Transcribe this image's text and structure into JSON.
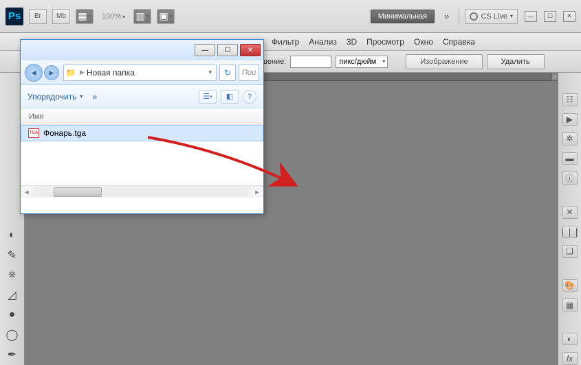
{
  "topbar": {
    "ps_label": "Ps",
    "br_label": "Br",
    "mb_label": "Mb",
    "zoom": "100%",
    "workspace": "Минимальная",
    "cs_live": "CS Live"
  },
  "menu": {
    "filter": "Фильтр",
    "analysis": "Анализ",
    "threed": "3D",
    "view": "Просмотр",
    "window": "Окно",
    "help": "Справка"
  },
  "options": {
    "resolution_label_fragment": "шение:",
    "resolution_value": "",
    "unit": "пикс/дюйм",
    "image_btn": "Изображение",
    "delete_btn": "Удалить"
  },
  "explorer": {
    "breadcrumb": "Новая папка",
    "search_placeholder": "Пои",
    "arrange": "Упорядочить",
    "column_name": "Имя",
    "file_icon_label": "TGA",
    "file_name": "Фонарь.tga"
  }
}
